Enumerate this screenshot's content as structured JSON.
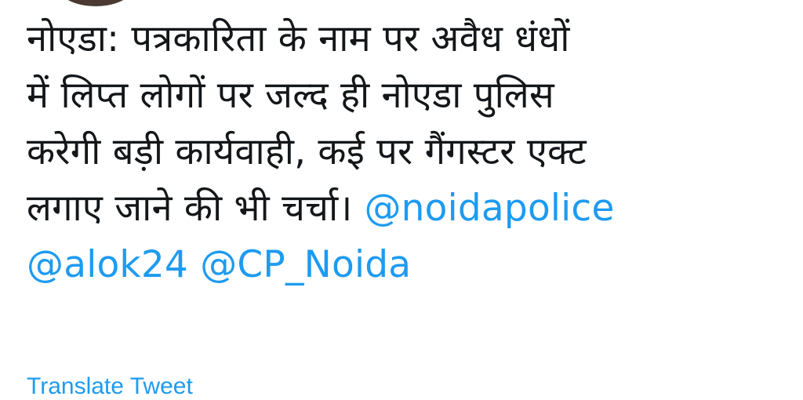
{
  "tweet": {
    "lines": [
      "नोएडा: पत्रकारिता के नाम पर अवैध धंधों",
      "में लिप्त लोगों पर जल्द ही नोएडा पुलिस",
      "करेगी बड़ी कार्यवाही, कई पर गैंगस्टर एक्ट",
      "लगाए जाने की भी चर्चा।"
    ],
    "mentions": [
      "@noidapolice",
      "@alok24",
      "@CP_Noida"
    ]
  },
  "translate_label": "Translate Tweet",
  "colors": {
    "text": "#14171a",
    "link": "#1d9bf0"
  }
}
